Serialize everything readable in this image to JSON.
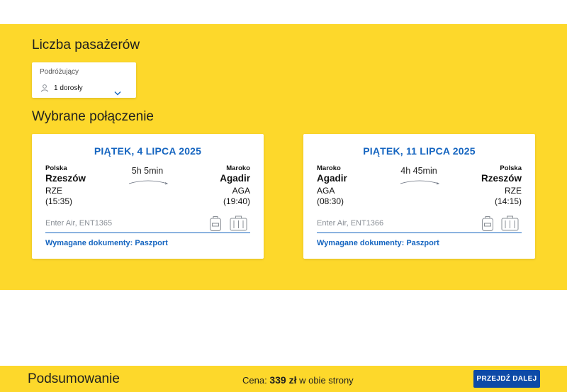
{
  "passengers": {
    "title": "Liczba pasażerów",
    "field_label": "Podróżujący",
    "field_value": "1 dorosły",
    "icon_user": "user-icon",
    "icon_chevron": "chevron-down-icon"
  },
  "connection": {
    "title": "Wybrane połączenie",
    "flights": [
      {
        "date": "PIĄTEK, 4 LIPCA 2025",
        "origin": {
          "country": "Polska",
          "city": "Rzeszów",
          "code": "RZE",
          "time": "(15:35)"
        },
        "destination": {
          "country": "Maroko",
          "city": "Agadir",
          "code": "AGA",
          "time": "(19:40)"
        },
        "duration": "5h 5min",
        "airline": "Enter Air, ENT1365",
        "documents": "Wymagane dokumenty: Paszport"
      },
      {
        "date": "PIĄTEK, 11 LIPCA 2025",
        "origin": {
          "country": "Maroko",
          "city": "Agadir",
          "code": "AGA",
          "time": "(08:30)"
        },
        "destination": {
          "country": "Polska",
          "city": "Rzeszów",
          "code": "RZE",
          "time": "(14:15)"
        },
        "duration": "4h 45min",
        "airline": "Enter Air, ENT1366",
        "documents": "Wymagane dokumenty: Paszport"
      }
    ]
  },
  "footer": {
    "title": "Podsumowanie",
    "price_label": "Cena:",
    "price_value": "339 zł",
    "price_suffix": "w obie strony",
    "cta_label": "PRZEJDŹ DALEJ"
  },
  "colors": {
    "brand_yellow": "#fdd82b",
    "accent_blue": "#1565c0",
    "button_blue": "#0d4aa7"
  }
}
